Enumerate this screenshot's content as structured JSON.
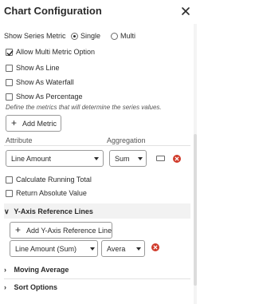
{
  "header": {
    "title": "Chart Configuration"
  },
  "series_metric": {
    "label": "Show Series Metric",
    "options": [
      {
        "label": "Single",
        "selected": true
      },
      {
        "label": "Multi",
        "selected": false
      }
    ]
  },
  "checkboxes": {
    "allow_multi": {
      "label": "Allow Multi Metric Option",
      "checked": true
    },
    "show_as_line": {
      "label": "Show As Line",
      "checked": false
    },
    "show_as_waterfall": {
      "label": "Show As Waterfall",
      "checked": false
    },
    "show_as_percentage": {
      "label": "Show As Percentage",
      "checked": false
    }
  },
  "metrics": {
    "hint": "Define the metrics that will determine the series values.",
    "add_button": "Add Metric",
    "attribute_label": "Attribute",
    "aggregation_label": "Aggregation",
    "attribute_value": "Line Amount",
    "aggregation_value": "Sum"
  },
  "metric_options": {
    "calc_running_total": {
      "label": "Calculate Running Total",
      "checked": false
    },
    "return_absolute": {
      "label": "Return Absolute Value",
      "checked": false
    }
  },
  "y_axis": {
    "section_label": "Y-Axis Reference Lines",
    "add_button": "Add Y-Axis Reference Line",
    "line_value": "Line Amount (Sum)",
    "type_value": "Avera"
  },
  "sections": {
    "moving_average": "Moving Average",
    "sort_options": "Sort Options"
  },
  "colors": {
    "delete_red": "#d03a2a",
    "text": "#2b2b2b",
    "section_bg": "#f2f2f2"
  }
}
